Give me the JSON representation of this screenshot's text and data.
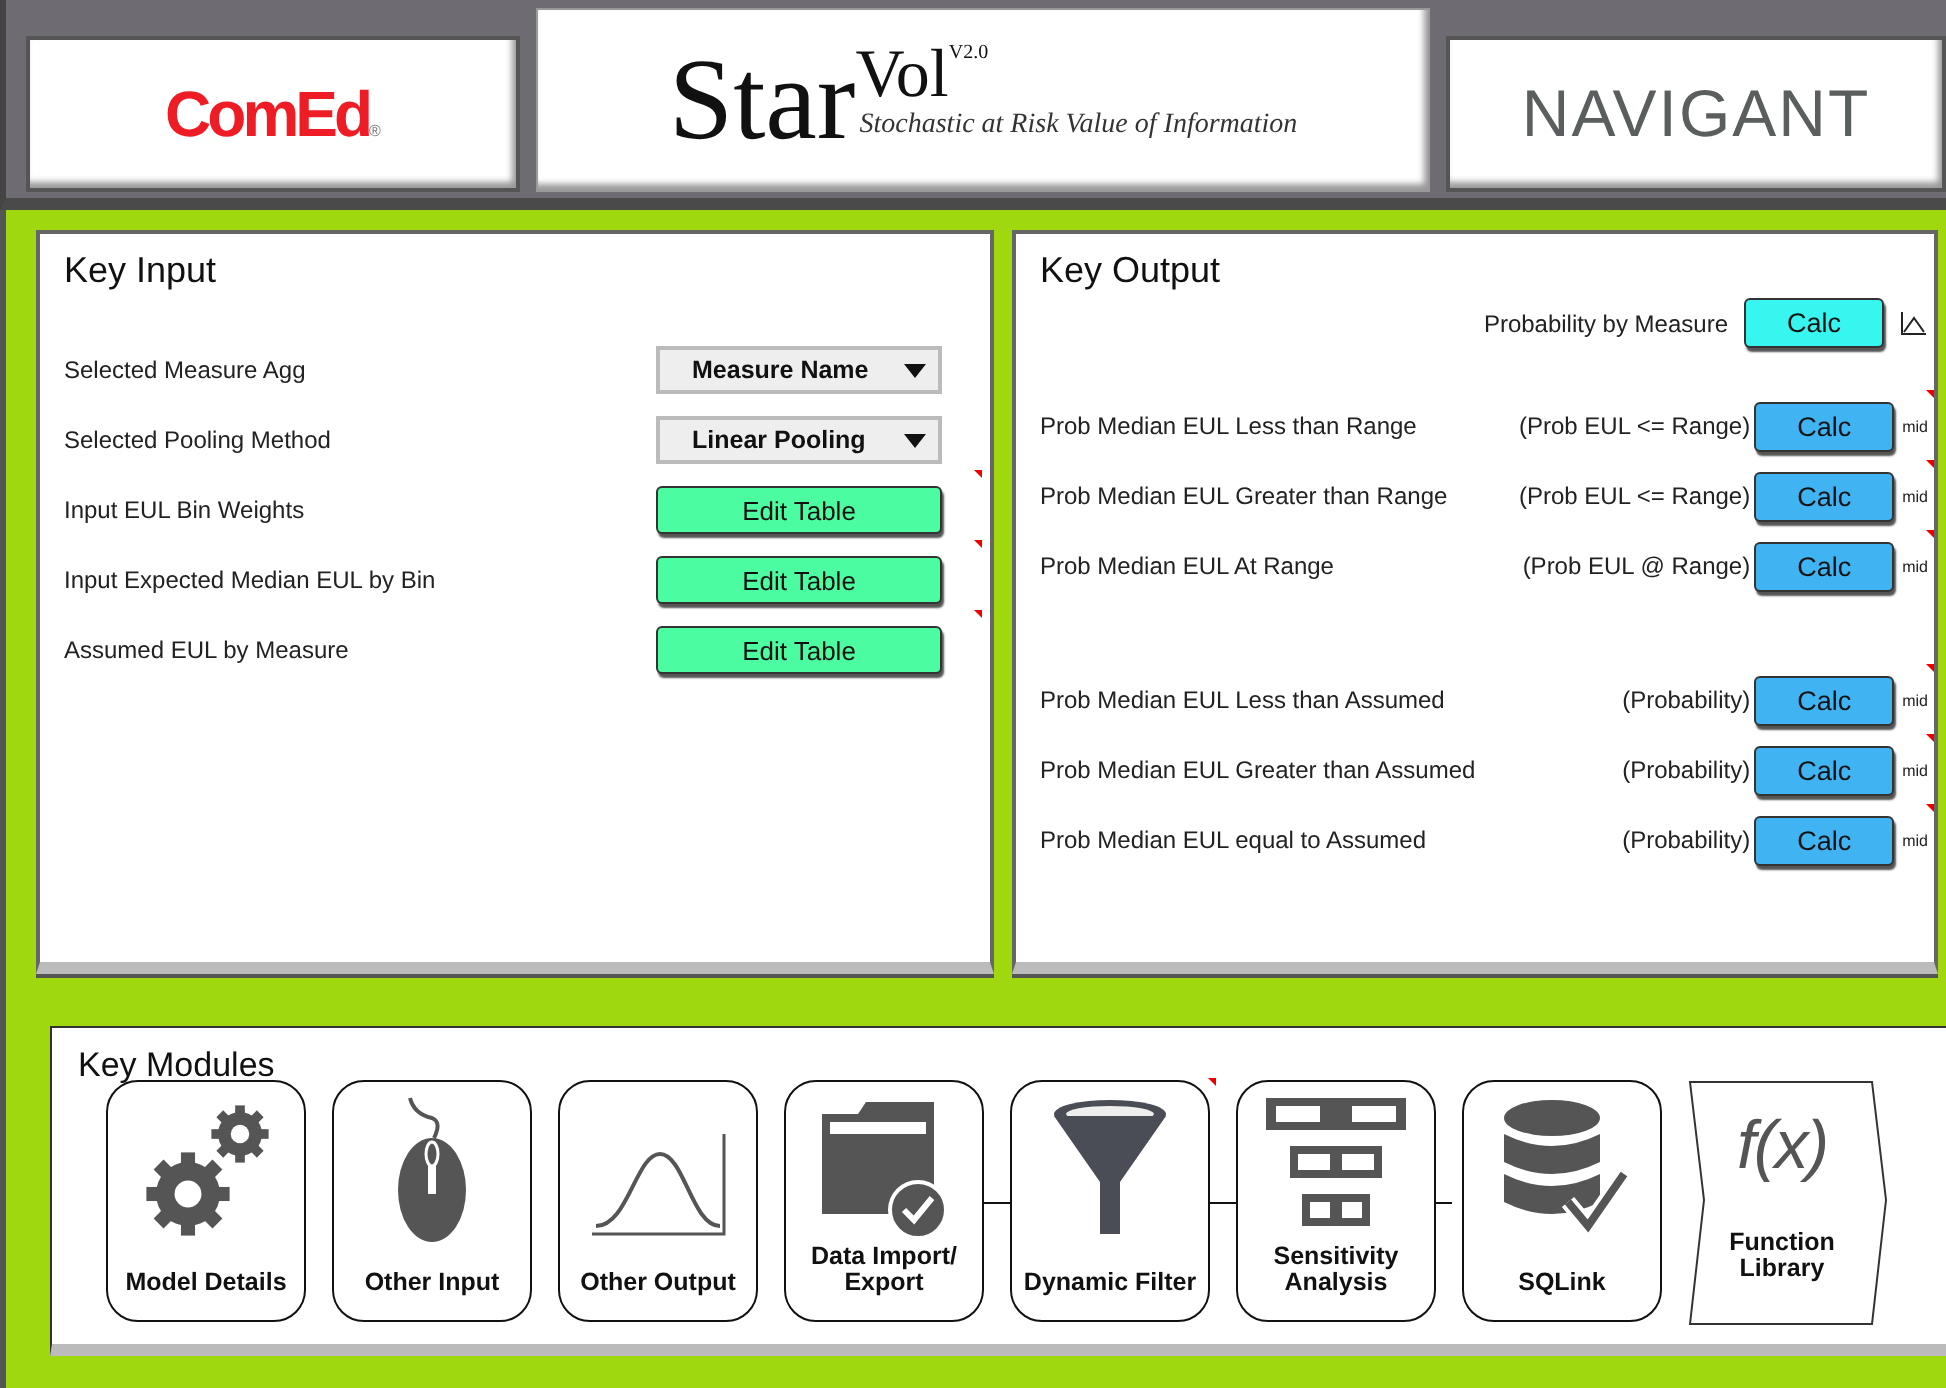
{
  "header": {
    "left_logo": "ComEd",
    "left_logo_mark": "®",
    "title": "Star",
    "title_raised": "Vol",
    "version": "V2.0",
    "subtitle": "Stochastic at Risk Value of Information",
    "right_logo": "NAVIGANT"
  },
  "key_input": {
    "title": "Key Input",
    "rows": [
      {
        "label": "Selected Measure Agg",
        "kind": "dropdown",
        "value": "Measure Name",
        "has_comment": false
      },
      {
        "label": "Selected Pooling Method",
        "kind": "dropdown",
        "value": "Linear Pooling",
        "has_comment": false
      },
      {
        "label": "Input EUL Bin Weights",
        "kind": "button",
        "value": "Edit Table",
        "has_comment": true
      },
      {
        "label": "Input Expected Median EUL by Bin",
        "kind": "button",
        "value": "Edit Table",
        "has_comment": true
      },
      {
        "label": "Assumed EUL by Measure",
        "kind": "button",
        "value": "Edit Table",
        "has_comment": true
      }
    ]
  },
  "key_output": {
    "title": "Key Output",
    "top": {
      "label": "Probability by Measure",
      "button": "Calc"
    },
    "groups": [
      [
        {
          "label": "Prob Median EUL Less than Range",
          "hint": "(Prob EUL <= Range)",
          "button": "Calc",
          "note": "mid",
          "has_comment": true
        },
        {
          "label": "Prob Median EUL Greater than Range",
          "hint": "(Prob EUL <= Range)",
          "button": "Calc",
          "note": "mid",
          "has_comment": true
        },
        {
          "label": "Prob Median EUL At Range",
          "hint": "(Prob EUL @ Range)",
          "button": "Calc",
          "note": "mid",
          "has_comment": true
        }
      ],
      [
        {
          "label": "Prob Median EUL Less than Assumed",
          "hint": "(Probability)",
          "button": "Calc",
          "note": "mid",
          "has_comment": true
        },
        {
          "label": "Prob Median EUL Greater than Assumed",
          "hint": "(Probability)",
          "button": "Calc",
          "note": "mid",
          "has_comment": true
        },
        {
          "label": "Prob Median EUL equal to Assumed",
          "hint": "(Probability)",
          "button": "Calc",
          "note": "mid",
          "has_comment": true
        }
      ]
    ]
  },
  "key_modules": {
    "title": "Key Modules",
    "modules": [
      {
        "label": "Model Details",
        "kind": "tile",
        "has_comment": false
      },
      {
        "label": "Other Input",
        "kind": "tile",
        "has_comment": false
      },
      {
        "label": "Other Output",
        "kind": "tile",
        "has_comment": false
      },
      {
        "label": "Data Import/ Export",
        "kind": "tile",
        "has_comment": false
      },
      {
        "label": "Dynamic Filter",
        "kind": "tile",
        "has_comment": true
      },
      {
        "label": "Sensitivity Analysis",
        "kind": "tile",
        "has_comment": false
      },
      {
        "label": "SQLink",
        "kind": "tile",
        "has_comment": false
      },
      {
        "label": "Function Library",
        "kind": "arrow",
        "symbol": "f(x)",
        "has_comment": false
      }
    ]
  }
}
